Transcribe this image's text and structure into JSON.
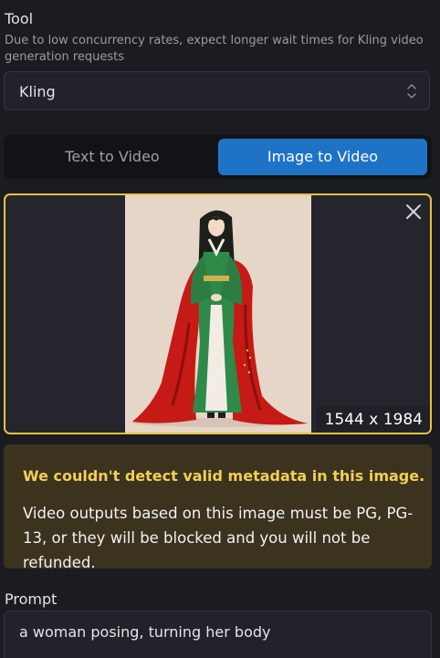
{
  "tool": {
    "label": "Tool",
    "hint": "Due to low concurrency rates, expect longer wait times for Kling video generation requests",
    "selected": "Kling"
  },
  "mode_tabs": {
    "text_to_video": "Text to Video",
    "image_to_video": "Image to Video",
    "active": "image_to_video"
  },
  "image": {
    "dimensions": "1544 x 1984",
    "close_icon": "close-icon"
  },
  "warning": {
    "title": "We couldn't detect valid metadata in this image.",
    "body": "Video outputs based on this image must be PG, PG-13, or they will be blocked and you will not be refunded."
  },
  "prompt": {
    "label": "Prompt",
    "value": "a woman posing, turning her body"
  },
  "colors": {
    "accent": "#1f73c7",
    "highlight_border": "#e9c23f",
    "warning_bg": "#3b331e",
    "warning_title": "#f2cf55"
  }
}
